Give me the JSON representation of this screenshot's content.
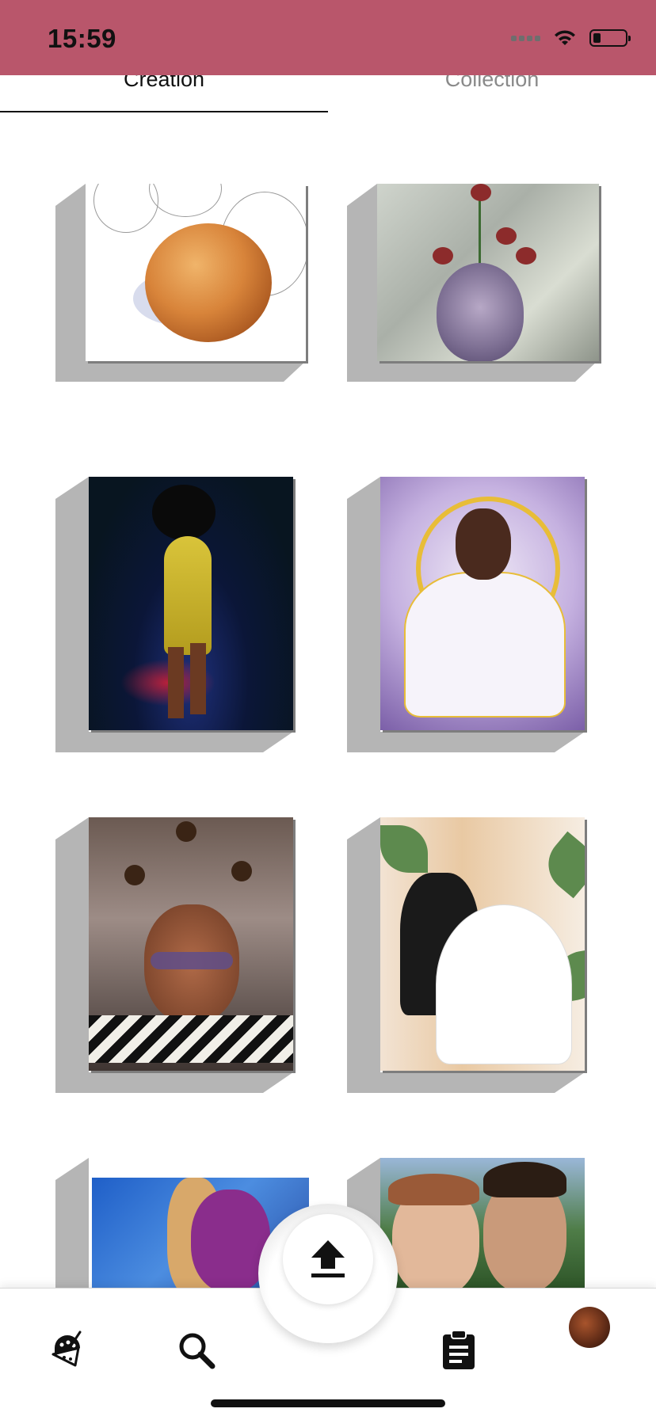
{
  "status_bar": {
    "time": "15:59",
    "battery_level": 0.22,
    "background": "#b9566b"
  },
  "tabs": [
    {
      "label": "Creation",
      "selected": true
    },
    {
      "label": "Collection",
      "selected": false
    }
  ],
  "gallery": {
    "items": [
      {
        "icon": "peach-painting"
      },
      {
        "icon": "rose-vase-painting"
      },
      {
        "icon": "yellow-suit-woman-painting"
      },
      {
        "icon": "crossed-arms-portrait-painting"
      },
      {
        "icon": "gold-glasses-portrait-painting"
      },
      {
        "icon": "wedding-couple-painting"
      },
      {
        "icon": "blue-pink-portrait-painting"
      },
      {
        "icon": "smiling-couple-painting"
      }
    ]
  },
  "bottom_nav": {
    "items": [
      {
        "icon": "palette-icon"
      },
      {
        "icon": "search-icon"
      },
      {
        "icon": "upload-icon"
      },
      {
        "icon": "clipboard-icon"
      },
      {
        "icon": "profile-avatar"
      }
    ]
  },
  "colors": {
    "accent": "#b9566b",
    "card_shadow": "#b5b5b5",
    "tab_active": "#111111",
    "tab_inactive": "#8a8a8a"
  }
}
